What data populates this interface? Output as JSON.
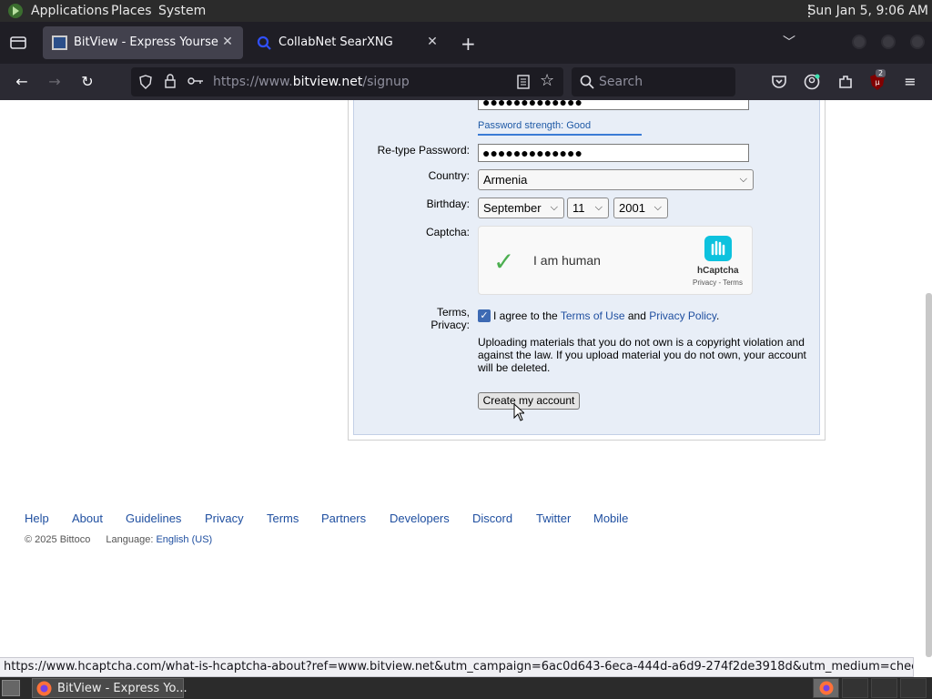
{
  "topbar": {
    "menus": [
      "Applications",
      "Places",
      "System"
    ],
    "clock": "Sun Jan  5,  9:06 AM"
  },
  "browser": {
    "tabs": [
      {
        "title": "BitView - Express Yourself.",
        "active": true
      },
      {
        "title": "CollabNet SearXNG",
        "active": false
      }
    ],
    "url_prefix": "https://www.",
    "url_domain": "bitview.net",
    "url_path": "/signup",
    "search_placeholder": "Search",
    "ublock_badge": "2"
  },
  "form": {
    "password_strength": "Password strength: Good",
    "retype_label": "Re-type Password:",
    "password_mask": "●●●●●●●●●●●●●",
    "country_label": "Country:",
    "country_value": "Armenia",
    "birthday_label": "Birthday:",
    "birth_month": "September",
    "birth_day": "11",
    "birth_year": "2001",
    "captcha_label": "Captcha:",
    "captcha_text": "I am human",
    "captcha_brand": "hCaptcha",
    "captcha_links": "Privacy - Terms",
    "terms_label_1": "Terms,",
    "terms_label_2": "Privacy:",
    "terms_pre": "I agree to the ",
    "terms_link": "Terms of Use",
    "terms_mid": " and ",
    "privacy_link": "Privacy Policy",
    "terms_post": ".",
    "warning": "Uploading materials that you do not own is a copyright violation and against the law. If you upload material you do not own, your account will be deleted.",
    "submit": "Create my account"
  },
  "footer": {
    "links": [
      "Help",
      "About",
      "Guidelines",
      "Privacy",
      "Terms",
      "Partners",
      "Developers",
      "Discord",
      "Twitter",
      "Mobile"
    ],
    "copyright": "© 2025 Bittoco",
    "language_label": "Language:",
    "language_value": "English (US)"
  },
  "statusbar": {
    "text": "https://www.hcaptcha.com/what-is-hcaptcha-about?ref=www.bitview.net&utm_campaign=6ac0d643-6eca-444d-a6d9-274f2de3918d&utm_medium=checkbox&hl=en"
  },
  "taskbar": {
    "task_title": "BitView - Express Yo..."
  },
  "colors": {
    "link": "#1f4fa0",
    "form_bg": "#e8eef7",
    "checkbox_green": "#4caf50"
  }
}
